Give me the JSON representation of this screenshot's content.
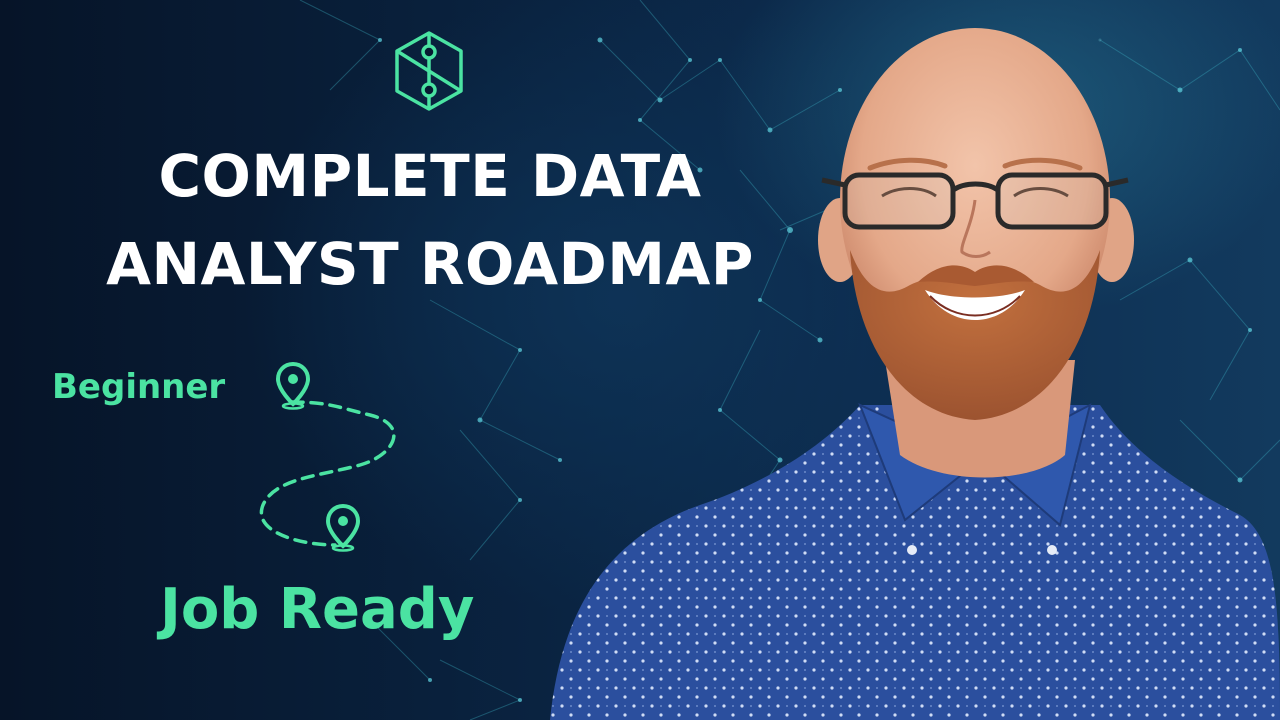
{
  "thumbnail": {
    "headline": {
      "line1": "COMPLETE DATA",
      "line2": "ANALYST ROADMAP"
    },
    "roadmap": {
      "start_label": "Beginner",
      "end_label": "Job Ready"
    },
    "icons": {
      "logo": "hexagon-network-logo-icon",
      "start_pin": "map-pin-icon",
      "end_pin": "map-pin-icon"
    },
    "colors": {
      "accent_green": "#4be3a2",
      "headline_white": "#ffffff",
      "background_navy": "#071a31",
      "shirt_blue": "#2b4f9e"
    }
  }
}
